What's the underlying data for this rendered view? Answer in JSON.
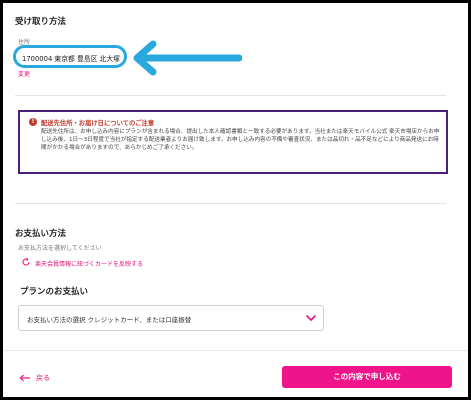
{
  "receive": {
    "title": "受け取り方法",
    "address_label": "住所",
    "address_value": "1700004 東京都 豊島区 北大塚",
    "change_link": "変更"
  },
  "notice": {
    "icon": "!",
    "title": "配送先住所・お届け日についてのご注意",
    "body": "配送先住所は、お申し込み内容にプランが含まれる場合、提出した本人確認書類と一致する必要があります。当社または楽天モバイル公式 楽天市場店からお申し込み後、1日〜3日程度で当社が指定する配送業者よりお届け致します。お申し込み内容の不備や審査状況、または品切れ・品不足などにより商品発送にお時間がかかる場合がありますので、あらかじめご了承ください。"
  },
  "payment": {
    "title": "お支払い方法",
    "subtitle": "お支払方法を選択してください",
    "switch_link": "楽天会員情報に紐づくカードを反映する"
  },
  "plan_payment": {
    "title": "プランのお支払い",
    "select_value": "お支払い方法の選択 クレジットカード、または口座振替"
  },
  "footer": {
    "back_label": "戻る",
    "submit_label": "この内容で申し込む"
  },
  "colors": {
    "accent_pink": "#e8117e",
    "arrow_blue": "#29a8de",
    "notice_border": "#4b1f7a",
    "notice_red": "#c0392b"
  },
  "icons": [
    "long-arrow-left-icon",
    "alert-icon",
    "refresh-icon",
    "chevron-down-icon",
    "back-arrow-icon"
  ]
}
